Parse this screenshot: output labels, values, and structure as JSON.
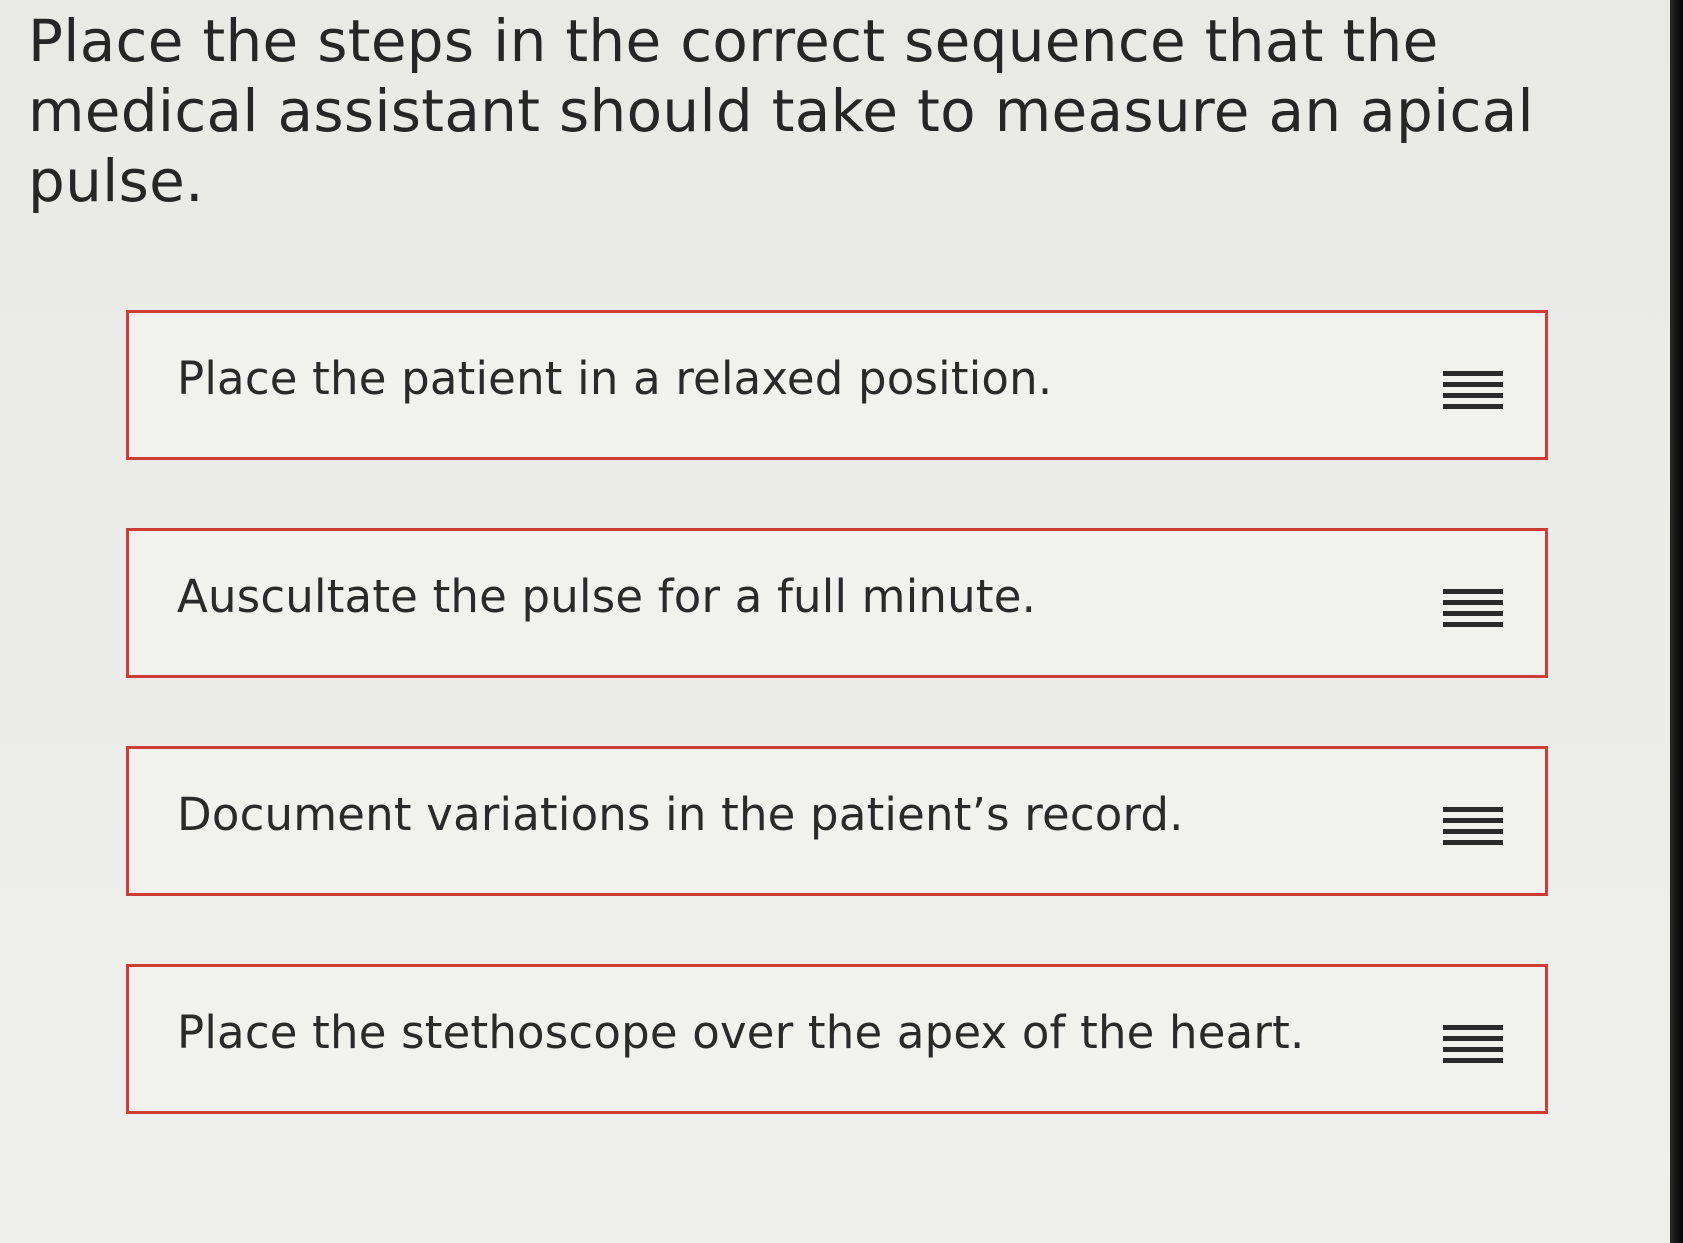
{
  "question": {
    "text": "Place the steps in the correct sequence that the medical assistant should take to measure an apical pulse."
  },
  "steps": [
    {
      "label": "Place the patient in a relaxed position.",
      "handle_icon": "drag-handle-icon"
    },
    {
      "label": "Auscultate the pulse for a full minute.",
      "handle_icon": "drag-handle-icon"
    },
    {
      "label": "Document variations in the patient’s record.",
      "handle_icon": "drag-handle-icon"
    },
    {
      "label": "Place the stethoscope over the apex of the heart.",
      "handle_icon": "drag-handle-icon"
    }
  ],
  "colors": {
    "item_border": "#cf3b35",
    "background": "#ececea",
    "text": "#262626"
  }
}
